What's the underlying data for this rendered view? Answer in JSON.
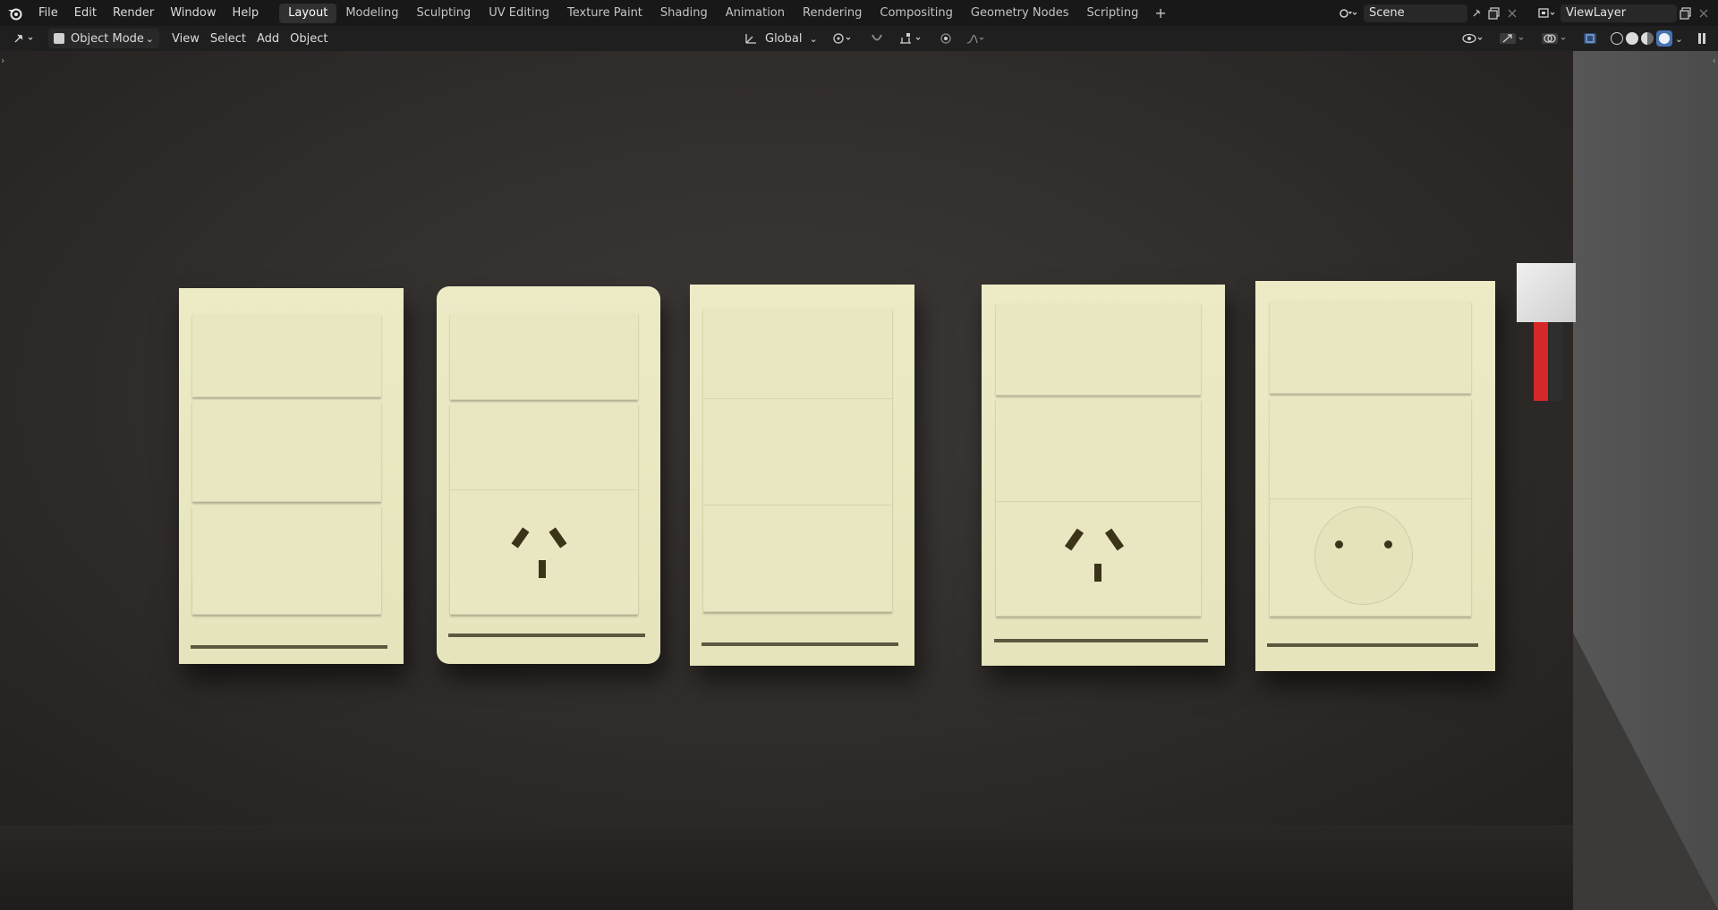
{
  "menu": [
    "File",
    "Edit",
    "Render",
    "Window",
    "Help"
  ],
  "workspaces": [
    "Layout",
    "Modeling",
    "Sculpting",
    "UV Editing",
    "Texture Paint",
    "Shading",
    "Animation",
    "Rendering",
    "Compositing",
    "Geometry Nodes",
    "Scripting"
  ],
  "active_workspace": "Layout",
  "add_workspace": "+",
  "scene": {
    "name": "Scene"
  },
  "view_layer": {
    "name": "ViewLayer"
  },
  "header": {
    "mode": "Object Mode",
    "menus": [
      "View",
      "Select",
      "Add",
      "Object"
    ],
    "transform_orientation": "Global"
  },
  "colors": {
    "accent": "#4772b3",
    "plate": "#e9e7c2",
    "cable_red": "#d62828"
  }
}
